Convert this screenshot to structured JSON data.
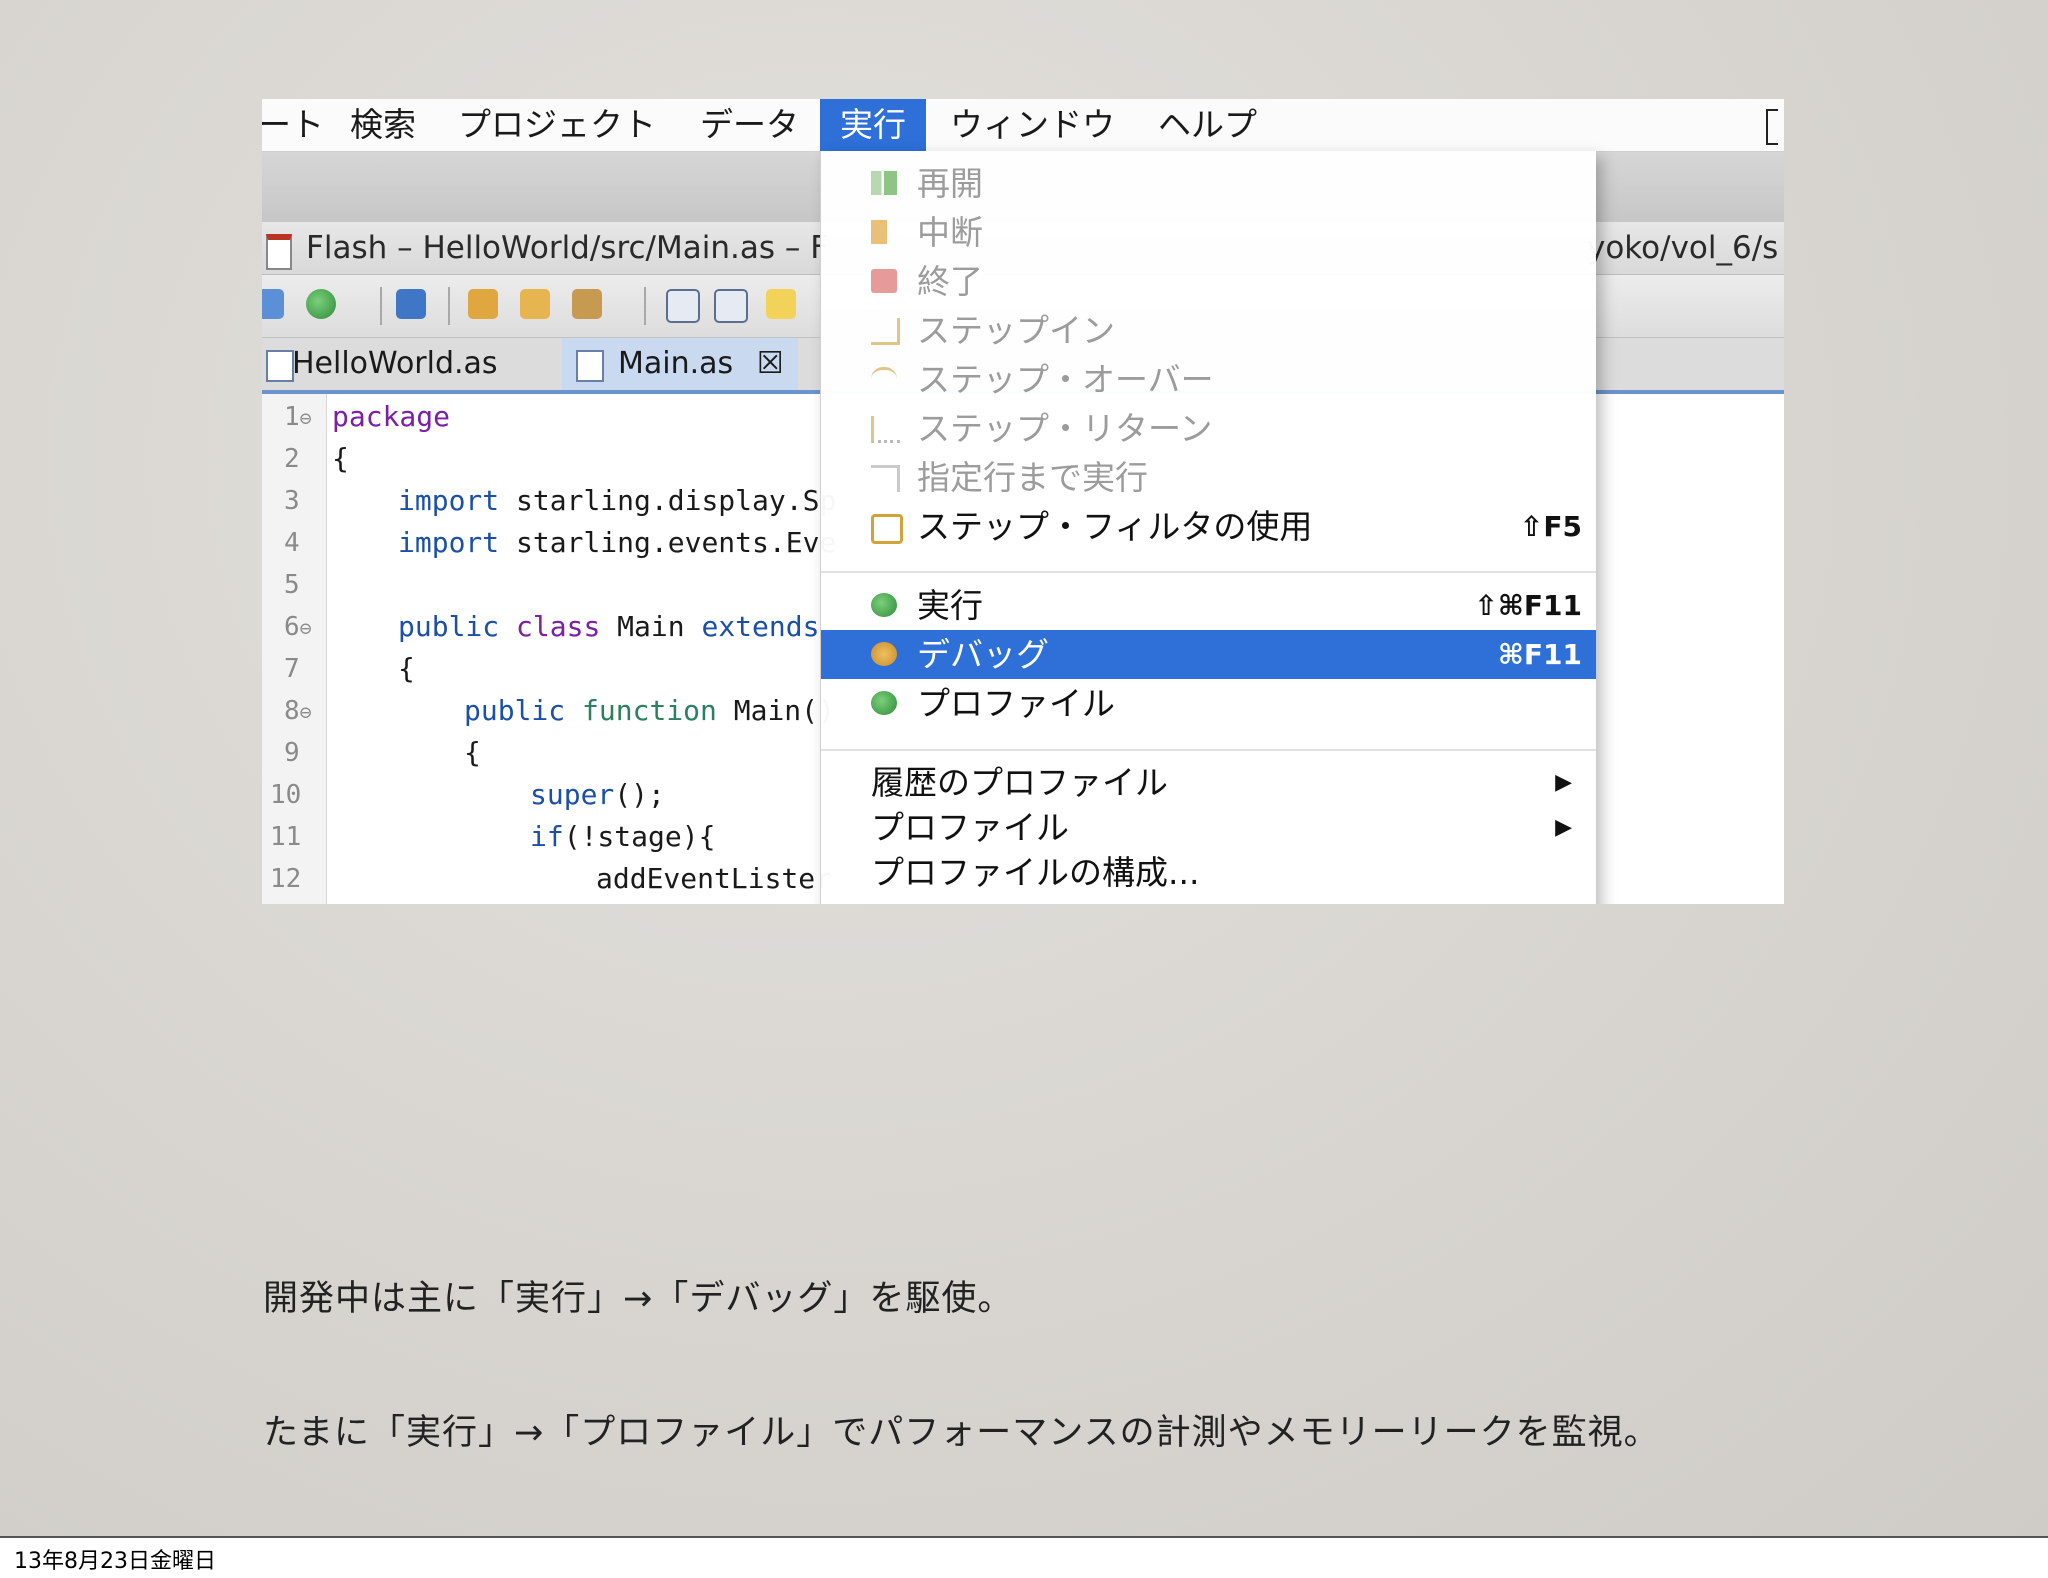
{
  "menubar": {
    "items": [
      "ート",
      "検索",
      "プロジェクト",
      "データ",
      "実行",
      "ウィンドウ",
      "ヘルプ"
    ],
    "active": "実行"
  },
  "window": {
    "title_left": "Flash – HelloWorld/src/Main.as – F",
    "title_right": "yoko/vol_6/s"
  },
  "tabs": [
    {
      "label": "HelloWorld.as"
    },
    {
      "label": "Main.as",
      "close_glyph": "☒"
    }
  ],
  "editor": {
    "lines": [
      {
        "n": "1",
        "fold": "⊖"
      },
      {
        "n": "2"
      },
      {
        "n": "3"
      },
      {
        "n": "4"
      },
      {
        "n": "5"
      },
      {
        "n": "6",
        "fold": "⊖"
      },
      {
        "n": "7"
      },
      {
        "n": "8",
        "fold": "⊖"
      },
      {
        "n": "9"
      },
      {
        "n": "10"
      },
      {
        "n": "11"
      },
      {
        "n": "12"
      }
    ],
    "code": {
      "l1_kw": "package",
      "l2": "{",
      "l3_kw": "import",
      "l3_rest": " starling.display.Sp",
      "l4_kw": "import",
      "l4_rest": " starling.events.Eve",
      "l6_kw1": "public",
      "l6_kw2": "class",
      "l6_name": " Main ",
      "l6_kw3": "extends",
      "l7": "{",
      "l8_kw1": "public",
      "l8_kw2": "function",
      "l8_name": " Main()",
      "l9": "{",
      "l10_kw": "super",
      "l10_rest": "();",
      "l11_kw": "if",
      "l11_rest": "(!stage){",
      "l12": "addEventLister"
    }
  },
  "run_menu": {
    "items_disabled": [
      {
        "label": "再開",
        "icon": "resume-icon"
      },
      {
        "label": "中断",
        "icon": "suspend-icon"
      },
      {
        "label": "終了",
        "icon": "terminate-icon"
      },
      {
        "label": "ステップイン",
        "icon": "step-into-icon"
      },
      {
        "label": "ステップ・オーバー",
        "icon": "step-over-icon"
      },
      {
        "label": "ステップ・リターン",
        "icon": "step-return-icon"
      },
      {
        "label": "指定行まで実行",
        "icon": "run-to-line-icon"
      }
    ],
    "step_filter": {
      "label": "ステップ・フィルタの使用",
      "shortcut": "⇧F5"
    },
    "run": {
      "label": "実行",
      "shortcut": "⇧⌘F11"
    },
    "debug": {
      "label": "デバッグ",
      "shortcut": "⌘F11"
    },
    "profile": {
      "label": "プロファイル"
    },
    "history_profile": {
      "label": "履歴のプロファイル"
    },
    "profile_sub": {
      "label": "プロファイル"
    },
    "profile_config": {
      "label": "プロファイルの構成..."
    }
  },
  "captions": {
    "line1": "開発中は主に「実行」→「デバッグ」を駆使。",
    "line2": "たまに「実行」→「プロファイル」でパフォーマンスの計測やメモリーリークを監視。"
  },
  "footer": {
    "date": "13年8月23日金曜日"
  },
  "colors": {
    "accent": "#2e6fd8",
    "keyword_purple": "#7a1fa6",
    "keyword_blue": "#1b4fa8"
  }
}
